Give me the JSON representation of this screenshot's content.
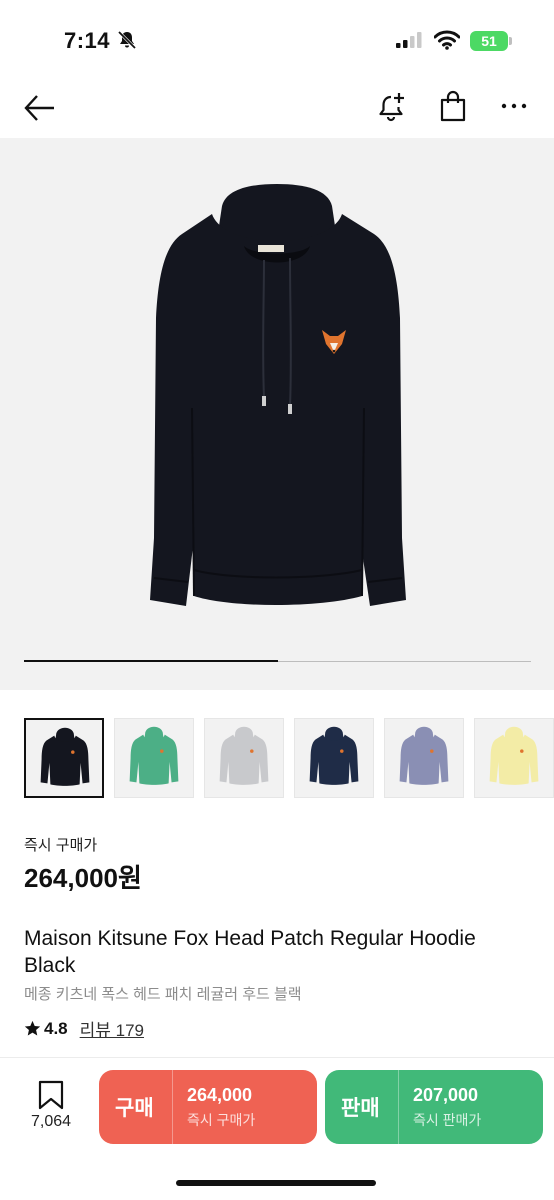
{
  "status_bar": {
    "time": "7:14",
    "battery": "51"
  },
  "product": {
    "price_label": "즉시 구매가",
    "price": "264,000원",
    "title": "Maison Kitsune Fox Head Patch Regular Hoodie Black",
    "subtitle": "메종 키츠네 폭스 헤드 패치 레귤러 후드 블랙",
    "rating": "4.8",
    "review_label": "리뷰 179"
  },
  "gallery": {
    "progress": 0.5,
    "thumbnails": [
      {
        "color": "#14161f",
        "selected": true
      },
      {
        "color": "#4caf86"
      },
      {
        "color": "#c8c9cc"
      },
      {
        "color": "#1f2c47"
      },
      {
        "color": "#8a8fb4"
      },
      {
        "color": "#f3eca6"
      }
    ]
  },
  "bottom_bar": {
    "wish_count": "7,064",
    "buy": {
      "label": "구매",
      "price": "264,000",
      "sub": "즉시 구매가",
      "color": "#ef6253"
    },
    "sell": {
      "label": "판매",
      "price": "207,000",
      "sub": "즉시 판매가",
      "color": "#41b979"
    }
  }
}
